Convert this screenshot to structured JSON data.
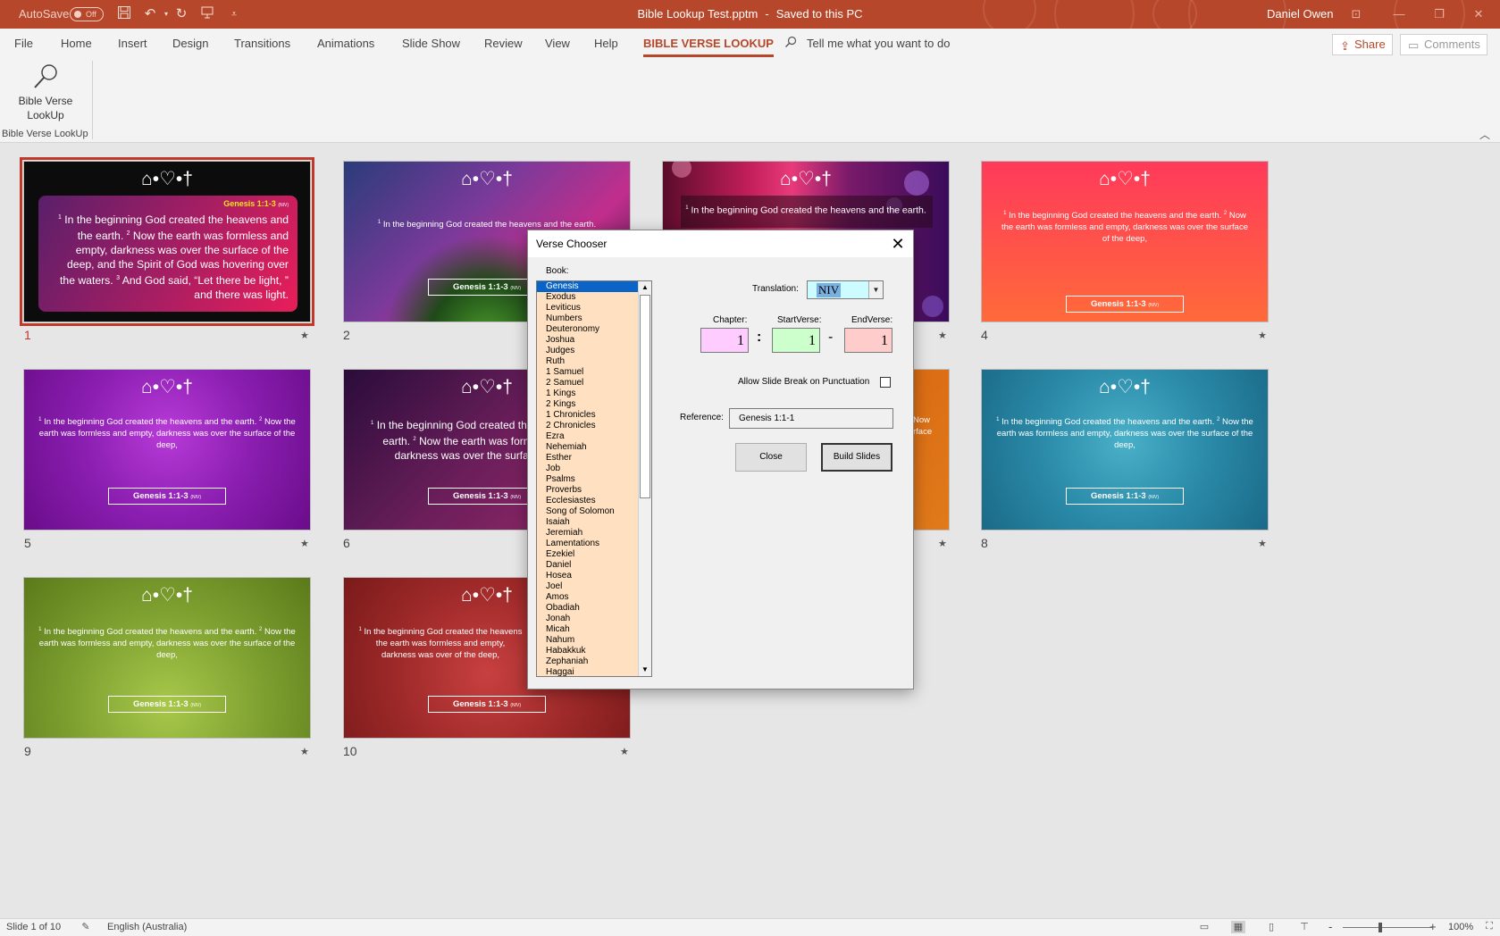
{
  "titlebar": {
    "autosave_label": "AutoSave",
    "autosave_state": "Off",
    "document_name": "Bible Lookup Test.pptm",
    "separator": "-",
    "save_status": "Saved to this PC",
    "user": "Daniel Owen",
    "accent": "#b7472a"
  },
  "ribbon": {
    "tabs": [
      "File",
      "Home",
      "Insert",
      "Design",
      "Transitions",
      "Animations",
      "Slide Show",
      "Review",
      "View",
      "Help",
      "BIBLE VERSE LOOKUP"
    ],
    "tell_me": "Tell me what you want to do",
    "share": "Share",
    "comments": "Comments",
    "button_label_line1": "Bible Verse",
    "button_label_line2": "LookUp",
    "group_label": "Bible Verse LookUp"
  },
  "slides": [
    {
      "num": "1",
      "icons": "⌂•♡•†",
      "ref": "Genesis 1:1-3",
      "tr": "(NIV)",
      "big_v1": "In the beginning God created the heavens and the earth.",
      "big_v2": "Now the earth was formless and empty, darkness was over the surface of the deep, and the Spirit of God was hovering over the waters.",
      "big_v3": "And God said, “Let there be light, ” and there was light."
    },
    {
      "num": "2",
      "icons": "⌂•♡•†",
      "verse": "In the beginning God created the heavens and the earth.",
      "ref": "Genesis 1:1-3",
      "tr": "(NIV)"
    },
    {
      "num": "3",
      "icons": "⌂•♡•†",
      "verse": "In the beginning God created the heavens and the earth."
    },
    {
      "num": "4",
      "icons": "⌂•♡•†",
      "verse": "In the beginning God created the heavens and the earth.",
      "verse2": "Now the earth was formless and empty, darkness was over the surface of the deep,",
      "ref": "Genesis 1:1-3",
      "tr": "(NIV)"
    },
    {
      "num": "5",
      "icons": "⌂•♡•†",
      "verse": "In the beginning God created the heavens and the earth.",
      "verse2": "Now the earth was formless and empty, darkness was over the surface of the deep,",
      "ref": "Genesis 1:1-3",
      "tr": "(NIV)"
    },
    {
      "num": "6",
      "icons": "⌂•♡•†",
      "verse": "In the beginning God created the heavens and the",
      "verse_cont": "earth.",
      "verse2": "Now the earth was form",
      "verse3": "darkness was over the surface",
      "ref": "Genesis 1:1-3",
      "tr": "(NIV)"
    },
    {
      "num": "7",
      "frag1": "Now",
      "frag2": "rface"
    },
    {
      "num": "8",
      "icons": "⌂•♡•†",
      "verse": "In the beginning God created the heavens and the earth.",
      "verse2": "Now the earth was formless and empty, darkness was over the surface of the deep,",
      "ref": "Genesis 1:1-3",
      "tr": "(NIV)"
    },
    {
      "num": "9",
      "icons": "⌂•♡•†",
      "verse": "In the beginning God created the heavens and the earth.",
      "verse2": "Now the earth was formless and empty, darkness was over the surface of the deep,",
      "ref": "Genesis 1:1-3",
      "tr": "(NIV)"
    },
    {
      "num": "10",
      "icons": "⌂•♡•†",
      "verse": "In the beginning God created the heavens",
      "verse2": "the earth was formless and empty, darkness was over",
      "verse3": "of the deep,",
      "ref": "Genesis 1:1-3",
      "tr": "(NIV)"
    }
  ],
  "dialog": {
    "title": "Verse Chooser",
    "book_label": "Book:",
    "books": [
      "Genesis",
      "Exodus",
      "Leviticus",
      "Numbers",
      "Deuteronomy",
      "Joshua",
      "Judges",
      "Ruth",
      "1 Samuel",
      "2 Samuel",
      "1 Kings",
      "2 Kings",
      "1 Chronicles",
      "2 Chronicles",
      "Ezra",
      "Nehemiah",
      "Esther",
      "Job",
      "Psalms",
      "Proverbs",
      "Ecclesiastes",
      "Song of Solomon",
      "Isaiah",
      "Jeremiah",
      "Lamentations",
      "Ezekiel",
      "Daniel",
      "Hosea",
      "Joel",
      "Amos",
      "Obadiah",
      "Jonah",
      "Micah",
      "Nahum",
      "Habakkuk",
      "Zephaniah",
      "Haggai"
    ],
    "selected_book": "Genesis",
    "translation_label": "Translation:",
    "translation": "NIV",
    "chapter_label": "Chapter:",
    "chapter": "1",
    "startverse_label": "StartVerse:",
    "startverse": "1",
    "endverse_label": "EndVerse:",
    "endverse": "1",
    "colon": ":",
    "dash": "-",
    "punct_label": "Allow Slide Break on Punctuation",
    "punct_checked": false,
    "reference_label": "Reference:",
    "reference": "Genesis 1:1-1",
    "close_btn": "Close",
    "build_btn": "Build Slides",
    "colors": {
      "list_bg": "#ffe0c0",
      "chapter_bg": "#ffccff",
      "startverse_bg": "#ccffcc",
      "endverse_bg": "#ffcccc",
      "translation_bg": "#ccfcff"
    }
  },
  "statusbar": {
    "slide_info": "Slide 1 of 10",
    "language": "English (Australia)",
    "zoom": "100%",
    "zoom_minus": "-",
    "zoom_plus": "+",
    "zoom_fraction": 0.42
  }
}
